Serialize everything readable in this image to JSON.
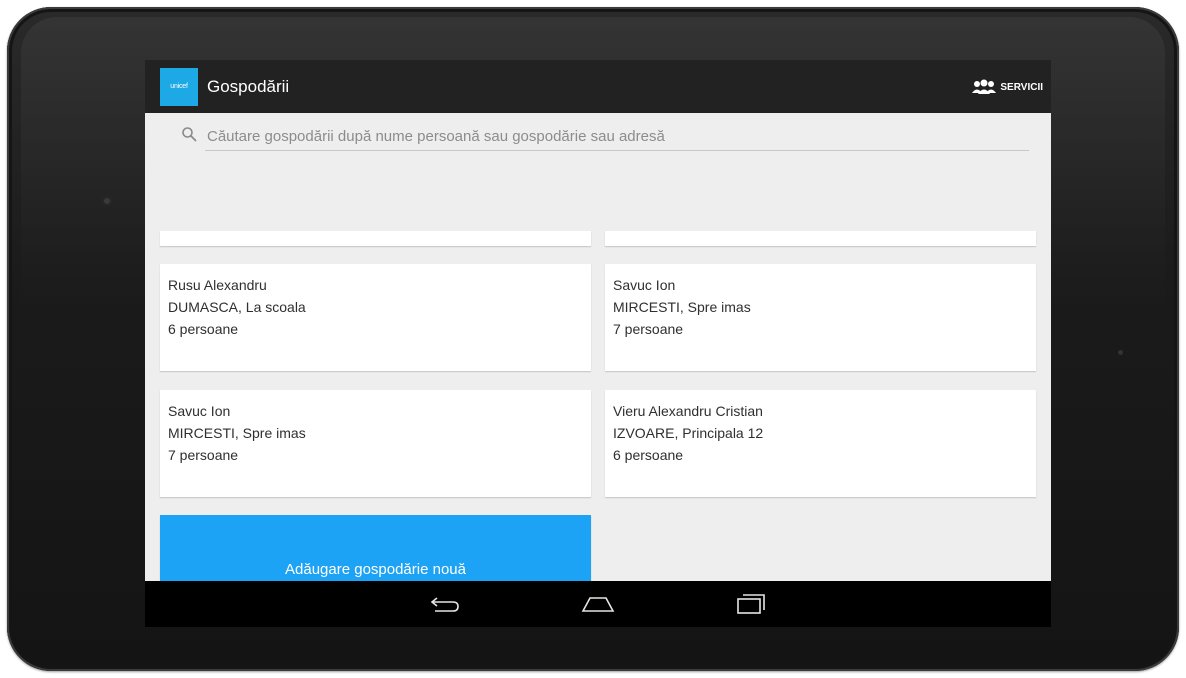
{
  "app": {
    "title": "Gospodării",
    "logo_text": "unicef",
    "services_label": "SERVICII"
  },
  "search": {
    "placeholder": "Căutare gospodării după nume persoană sau gospodărie sau adresă",
    "value": ""
  },
  "households": [
    {
      "name": "Rusu Alexandru",
      "address": "DUMASCA, La scoala",
      "persons": "6 persoane"
    },
    {
      "name": "Savuc Ion",
      "address": "MIRCESTI, Spre imas",
      "persons": "7 persoane"
    },
    {
      "name": "Savuc Ion",
      "address": "MIRCESTI, Spre imas",
      "persons": "7 persoane"
    },
    {
      "name": "Vieru Alexandru Cristian",
      "address": "IZVOARE, Principala 12",
      "persons": "6 persoane"
    }
  ],
  "add_button": {
    "label": "Adăugare gospodărie nouă"
  },
  "navigation": {
    "icons": [
      "back-icon",
      "home-icon",
      "recent-apps-icon"
    ]
  },
  "colors": {
    "action_bar": "#222222",
    "accent": "#1ca3f5",
    "content_background": "#eeeeee",
    "card_background": "#ffffff"
  }
}
